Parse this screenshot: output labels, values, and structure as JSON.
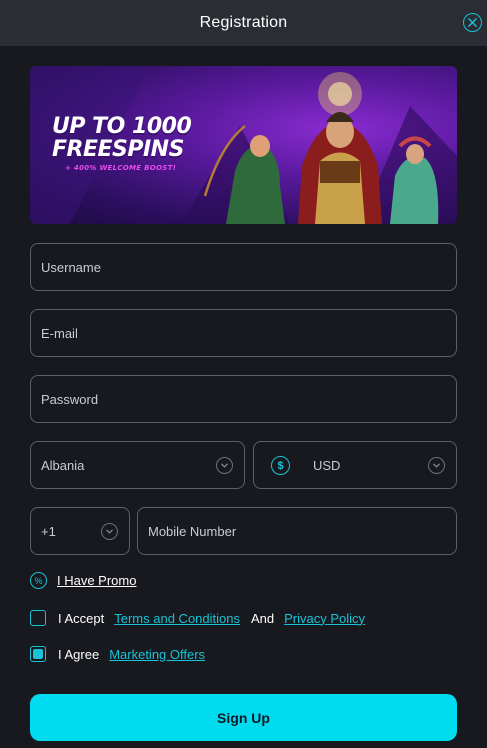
{
  "header": {
    "title": "Registration",
    "close_icon": "close-icon"
  },
  "banner": {
    "line1": "UP TO 1000",
    "line2": "FREESPINS",
    "subline": "+ 400% WELCOME BOOST!"
  },
  "form": {
    "username_placeholder": "Username",
    "email_placeholder": "E-mail",
    "password_placeholder": "Password",
    "country_value": "Albania",
    "currency_value": "USD",
    "currency_icon": "dollar-icon",
    "phone_code_value": "+1",
    "mobile_placeholder": "Mobile Number"
  },
  "promo": {
    "label": "I Have Promo",
    "icon": "percent-icon"
  },
  "terms": {
    "prefix": "I Accept",
    "terms_link": "Terms and Conditions",
    "and": "And",
    "privacy_link": "Privacy Policy",
    "checked": false
  },
  "marketing": {
    "prefix": "I Agree",
    "offers_link": "Marketing Offers",
    "checked": true
  },
  "submit": {
    "label": "Sign Up"
  },
  "colors": {
    "accent": "#17c3d6",
    "button": "#00dcef",
    "background": "#17191e",
    "header": "#2a2d34"
  }
}
